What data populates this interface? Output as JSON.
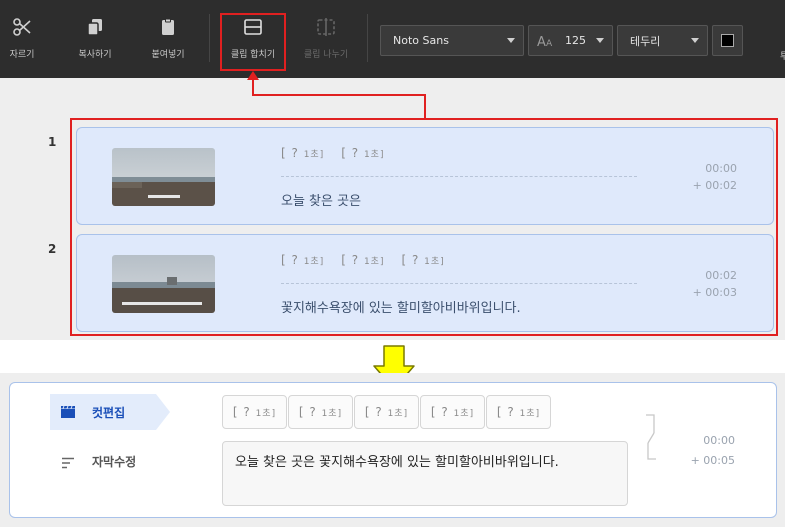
{
  "toolbar": {
    "buttons": [
      {
        "label": "자르기",
        "icon": "scissors-icon"
      },
      {
        "label": "복사하기",
        "icon": "copy-icon"
      },
      {
        "label": "붙여넣기",
        "icon": "paste-icon"
      },
      {
        "label": "클립 합치기",
        "icon": "merge-clips-icon"
      },
      {
        "label": "클립 나누기",
        "icon": "split-clip-icon"
      }
    ],
    "font_family": "Noto Sans",
    "font_size": "125",
    "text_style": "테두리",
    "text_color": "#000000",
    "cut_label": "투"
  },
  "clips": [
    {
      "number": "1",
      "markers": [
        {
          "text": "[ ?",
          "unit": "1초]"
        },
        {
          "text": "[ ?",
          "unit": "1초]"
        }
      ],
      "text": "오늘 찾은 곳은",
      "start": "00:00",
      "end": "+ 00:02"
    },
    {
      "number": "2",
      "markers": [
        {
          "text": "[ ?",
          "unit": "1초]"
        },
        {
          "text": "[ ?",
          "unit": "1초]"
        },
        {
          "text": "[ ?",
          "unit": "1초]"
        }
      ],
      "text": "꽃지해수욕장에 있는 할미할아비바위입니다.",
      "start": "00:02",
      "end": "+ 00:03"
    }
  ],
  "merged": {
    "sidebar": [
      {
        "label": "컷편집",
        "active": true,
        "icon": "clapperboard-icon"
      },
      {
        "label": "자막수정",
        "active": false,
        "icon": "text-lines-icon"
      }
    ],
    "markers": [
      {
        "text": "[ ?",
        "unit": "1초]"
      },
      {
        "text": "[ ?",
        "unit": "1초]"
      },
      {
        "text": "[ ?",
        "unit": "1초]"
      },
      {
        "text": "[ ?",
        "unit": "1초]"
      },
      {
        "text": "[ ?",
        "unit": "1초]"
      }
    ],
    "text": "오늘 찾은 곳은 꽃지해수욕장에 있는 할미할아비바위입니다.",
    "start": "00:00",
    "end": "+ 00:05"
  },
  "colors": {
    "highlight_red": "#e02020",
    "arrow_yellow": "#ffff00",
    "card_blue": "#dfe9fb",
    "toolbar_bg": "#2d2d2d"
  }
}
